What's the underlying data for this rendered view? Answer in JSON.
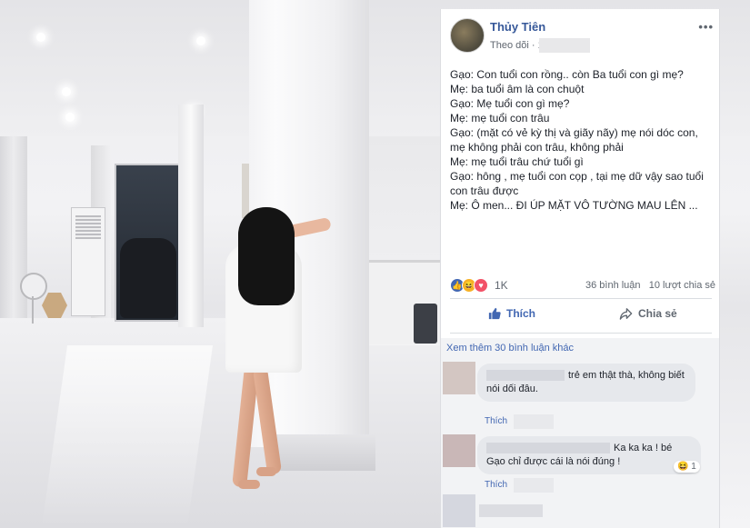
{
  "post": {
    "author": "Thủy Tiên",
    "meta": "Theo dõi · 1",
    "lines": [
      "Gạo: Con tuổi con rồng.. còn Ba tuổi con gì mẹ?",
      "Mẹ: ba tuổi âm là con chuột",
      "Gạo: Mẹ tuổi con gì mẹ?",
      "Mẹ: mẹ tuổi con trâu",
      "Gạo: (mặt có vẻ kỳ thị và giãy nãy) mẹ nói dóc con,",
      "mẹ không phải con trâu, không phải",
      "Mẹ: mẹ tuổi trâu chứ tuổi gì",
      "Gạo: hông , mẹ tuổi con cọp , tại mẹ dữ vậy sao tuổi",
      "con trâu được",
      "Mẹ: Ô men... ĐI ÚP MẶT VÔ TƯỜNG MAU LÊN ..."
    ]
  },
  "reactions": {
    "count": "1K",
    "comments": "36 bình luận",
    "shares": "10 lượt chia sẻ"
  },
  "actions": {
    "like": "Thích",
    "share": "Chia sẻ"
  },
  "comments": {
    "more": "Xem thêm 30 bình luận khác",
    "items": [
      {
        "text_line1": "trẻ em thật thà, không biết",
        "text_line2": "nói dối đâu.",
        "like": "Thích"
      },
      {
        "text_line1": "Ka ka ka ! bé",
        "text_line2": "Gạo chỉ được cái là nói đúng !",
        "like": "Thích",
        "reaction_count": "1"
      }
    ]
  },
  "colors": {
    "link": "#365899",
    "brand": "#4267b2"
  },
  "icons": [
    "more-icon",
    "like-icon",
    "share-icon",
    "haha-icon",
    "love-icon"
  ]
}
